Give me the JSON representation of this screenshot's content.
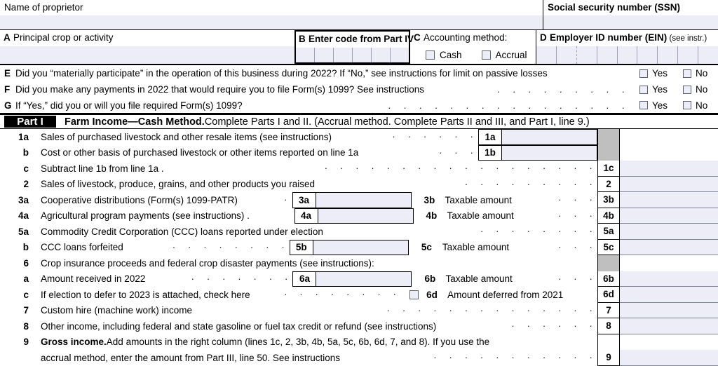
{
  "header": {
    "name_label": "Name of proprietor",
    "ssn_label": "Social security number (SSN)",
    "a_key": "A",
    "a_label": "Principal crop or activity",
    "b_key": "B",
    "b_label": "Enter code from Part IV",
    "c_key": "C",
    "c_label": "Accounting method:",
    "c_opt1": "Cash",
    "c_opt2": "Accrual",
    "d_key": "D",
    "d_label": "Employer ID number (EIN)",
    "d_note": "(see instr.)"
  },
  "questions": [
    {
      "key": "E",
      "text": "Did you “materially participate” in the operation of this business during 2022? If “No,” see instructions for limit on passive losses",
      "dots": "",
      "yes": "Yes",
      "no": "No"
    },
    {
      "key": "F",
      "text": "Did you make any payments in 2022 that would require you to file Form(s) 1099? See instructions",
      "dots": ". . . . . . . . .",
      "yes": "Yes",
      "no": "No"
    },
    {
      "key": "G",
      "text": "If “Yes,” did you or will you file required Form(s) 1099?",
      "dots": ". . . . . . . . . . . . . . . .",
      "yes": "Yes",
      "no": "No"
    }
  ],
  "part": {
    "chip": "Part I",
    "title_bold": "Farm Income—Cash Method.",
    "title_rest": " Complete Parts I and II. (Accrual method. Complete Parts II and III, and Part I, line 9.)"
  },
  "lines": {
    "l1a": {
      "num": "1a",
      "text": "Sales of purchased livestock and other resale items (see instructions)",
      "dots": ". . . . . .",
      "mid_num": "1a"
    },
    "l1b": {
      "num": "b",
      "text": "Cost or other basis of purchased livestock or other items reported on line 1a",
      "dots": ". . .",
      "mid_num": "1b"
    },
    "l1c": {
      "num": "c",
      "text": "Subtract line 1b from line 1a .",
      "dots": ". . . . . . . . . . . . . . . . . .",
      "right_num": "1c"
    },
    "l2": {
      "num": "2",
      "text": "Sales of livestock, produce, grains, and other products you raised",
      "dots": ". . . . . . . . .",
      "right_num": "2"
    },
    "l3a": {
      "num": "3a",
      "text": "Cooperative distributions (Form(s) 1099-PATR)",
      "dots": ".",
      "mid_num": "3a",
      "tb_key": "3b",
      "tb_text": "Taxable amount",
      "tb_dots": ". . .",
      "right_num": "3b"
    },
    "l4a": {
      "num": "4a",
      "text": "Agricultural program payments (see instructions) .",
      "dots": "",
      "mid_num": "4a",
      "tb_key": "4b",
      "tb_text": "Taxable amount",
      "tb_dots": ". . .",
      "right_num": "4b"
    },
    "l5a": {
      "num": "5a",
      "text": "Commodity Credit Corporation (CCC) loans reported under election",
      "dots": ". . . . . . . .",
      "right_num": "5a"
    },
    "l5b": {
      "num": "b",
      "text": "CCC loans forfeited",
      "dots": ". . . . . . . .",
      "mid_num": "5b",
      "tb_key": "5c",
      "tb_text": "Taxable amount",
      "tb_dots": ". . .",
      "right_num": "5c"
    },
    "l6": {
      "num": "6",
      "text": "Crop insurance proceeds and federal crop disaster payments (see instructions):"
    },
    "l6a": {
      "num": "a",
      "text": "Amount received in 2022",
      "dots": ". . . . . . .",
      "mid_num": "6a",
      "tb_key": "6b",
      "tb_text": "Taxable amount",
      "tb_dots": ". . .",
      "right_num": "6b"
    },
    "l6c": {
      "num": "c",
      "text": "If election to defer to 2023 is attached, check here",
      "dots": ". . . . . . . .",
      "tb_key": "6d",
      "tb_text": "Amount deferred from 2021",
      "right_num": "6d"
    },
    "l7": {
      "num": "7",
      "text": "Custom hire (machine work) income",
      "dots": ". . . . . . . . . . . . . .",
      "right_num": "7"
    },
    "l8": {
      "num": "8",
      "text": "Other income, including federal and state gasoline or fuel tax credit or refund (see instructions)",
      "dots": ". . . . . .",
      "right_num": "8"
    },
    "l9": {
      "num": "9",
      "text_bold": "Gross income.",
      "text": " Add amounts in the right column (lines 1c, 2, 3b, 4b, 5a, 5c, 6b, 6d, 7, and 8). If you use the",
      "text2": "accrual method, enter the amount from Part III, line 50. See instructions",
      "dots2": ". . . . . . . . . . .",
      "right_num": "9"
    }
  },
  "colors": {
    "field_fill": "#ecedf6",
    "gray_block": "#bfbfbf",
    "rule": "#000000"
  }
}
